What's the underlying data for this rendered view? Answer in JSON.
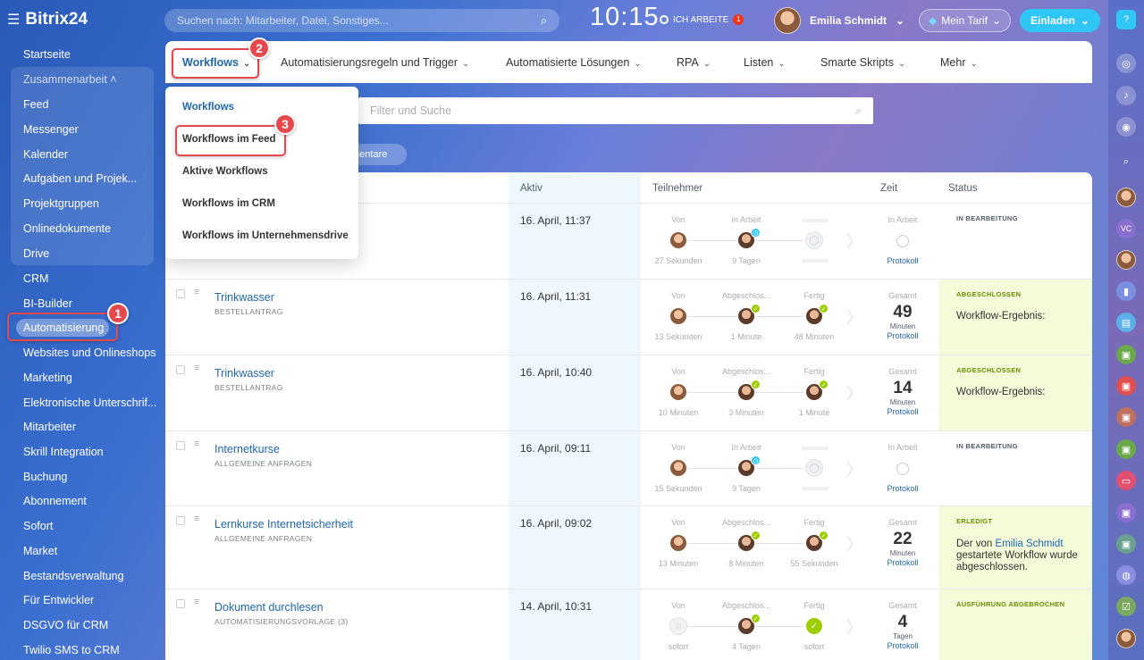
{
  "header": {
    "logo": "Bitrix24",
    "search_placeholder": "Suchen nach: Mitarbeiter, Datei, Sonstiges...",
    "clock": "10:15",
    "work_status": "ICH ARBEITE",
    "work_badge": "1",
    "user_name": "Emilia Schmidt",
    "tarif": "Mein Tarif",
    "invite": "Einladen"
  },
  "sidebar": {
    "startseite": "Startseite",
    "group_title": "Zusammenarbeit",
    "group_items": [
      "Feed",
      "Messenger",
      "Kalender",
      "Aufgaben und Projek...",
      "Projektgruppen",
      "Onlinedokumente",
      "Drive"
    ],
    "items": [
      "CRM",
      "BI-Builder",
      "Automatisierung",
      "Websites und Onlineshops",
      "Marketing",
      "Elektronische Unterschrif...",
      "Mitarbeiter",
      "Skrill Integration",
      "Buchung",
      "Abonnement",
      "Sofort",
      "Market",
      "Bestandsverwaltung",
      "Für Entwickler",
      "DSGVO für CRM",
      "Twilio SMS to CRM"
    ]
  },
  "tabs": [
    "Workflows",
    "Automatisierungsregeln und Trigger",
    "Automatisierte Lösungen",
    "RPA",
    "Listen",
    "Smarte Skripts",
    "Mehr"
  ],
  "filter_placeholder": "Filter und Suche",
  "pill_label": "mentare",
  "dropdown": [
    "Workflows",
    "Workflows im Feed",
    "Aktive Workflows",
    "Workflows im CRM",
    "Workflows im Unternehmensdrive"
  ],
  "grid": {
    "headers": {
      "aktiv": "Aktiv",
      "teilnehmer": "Teilnehmer",
      "zeit": "Zeit",
      "status": "Status"
    },
    "rows": [
      {
        "title": "",
        "sub": "",
        "date": "16. April, 11:37",
        "p_labels": [
          "Von",
          "In Arbeit",
          ""
        ],
        "p_times": [
          "27 Sekunden",
          "9 Tagen",
          ""
        ],
        "zeit_label": "In Arbeit",
        "zeit_num": "",
        "zeit_unit": "",
        "zeit_link": "Protokoll",
        "status_label": "IN BEARBEITUNG",
        "status_text": ""
      },
      {
        "title": "Trinkwasser",
        "sub": "BESTELLANTRAG",
        "date": "16. April, 11:31",
        "p_labels": [
          "Von",
          "Abgeschlos...",
          "Fertig"
        ],
        "p_times": [
          "13 Sekunden",
          "1 Minute",
          "48 Minuten"
        ],
        "zeit_label": "Gesamt",
        "zeit_num": "49",
        "zeit_unit": "Minuten",
        "zeit_link": "Protokoll",
        "status_label": "ABGESCHLOSSEN",
        "status_text": "Workflow-Ergebnis:"
      },
      {
        "title": "Trinkwasser",
        "sub": "BESTELLANTRAG",
        "date": "16. April, 10:40",
        "p_labels": [
          "Von",
          "Abgeschlos...",
          "Fertig"
        ],
        "p_times": [
          "10 Minuten",
          "3 Minuten",
          "1 Minute"
        ],
        "zeit_label": "Gesamt",
        "zeit_num": "14",
        "zeit_unit": "Minuten",
        "zeit_link": "Protokoll",
        "status_label": "ABGESCHLOSSEN",
        "status_text": "Workflow-Ergebnis:"
      },
      {
        "title": "Internetkurse",
        "sub": "ALLGEMEINE ANFRAGEN",
        "date": "16. April, 09:11",
        "p_labels": [
          "Von",
          "In Arbeit",
          ""
        ],
        "p_times": [
          "15 Sekunden",
          "9 Tagen",
          ""
        ],
        "zeit_label": "In Arbeit",
        "zeit_num": "",
        "zeit_unit": "",
        "zeit_link": "Protokoll",
        "status_label": "IN BEARBEITUNG",
        "status_text": ""
      },
      {
        "title": "Lernkurse Internetsicherheit",
        "sub": "ALLGEMEINE ANFRAGEN",
        "date": "16. April, 09:02",
        "p_labels": [
          "Von",
          "Abgeschlos...",
          "Fertig"
        ],
        "p_times": [
          "13 Minuten",
          "8 Minuten",
          "55 Sekunden"
        ],
        "zeit_label": "Gesamt",
        "zeit_num": "22",
        "zeit_unit": "Minuten",
        "zeit_link": "Protokoll",
        "status_label": "ERLEDIGT",
        "status_text_pre": "Der von ",
        "status_link": "Emilia Schmidt",
        "status_text_post": " gestartete Workflow wurde abgeschlossen."
      },
      {
        "title": "Dokument durchlesen",
        "sub": "AUTOMATISIERUNGSVORLAGE (3)",
        "date": "14. April, 10:31",
        "p_labels": [
          "Von",
          "Abgeschlos...",
          "Fertig"
        ],
        "p_times": [
          "sofort",
          "4 Tagen",
          "sofort"
        ],
        "zeit_label": "Gesamt",
        "zeit_num": "4",
        "zeit_unit": "Tagen",
        "zeit_link": "Protokoll",
        "status_label": "AUSFÜHRUNG ABGEBROCHEN",
        "status_text": ""
      }
    ]
  },
  "callouts": [
    "1",
    "2",
    "3"
  ],
  "colors": {
    "accent": "#2067b0",
    "callout": "#e5484d",
    "success": "#9dcf00",
    "invite": "#2fc6f6"
  }
}
